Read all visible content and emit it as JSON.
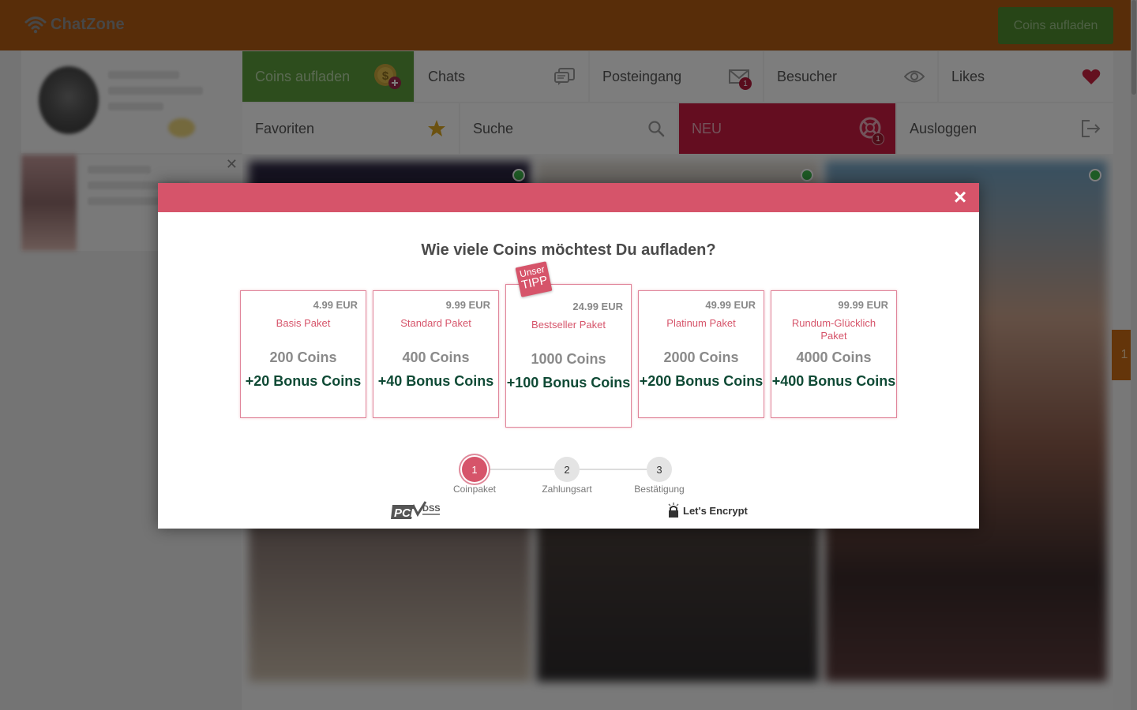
{
  "header": {
    "logo_text": "ChatZone",
    "cta_label": "Coins aufladen"
  },
  "nav": {
    "row1": [
      {
        "label": "Coins aufladen",
        "icon": "coin-plus-icon",
        "style": "green"
      },
      {
        "label": "Chats",
        "icon": "chat-bubbles-icon"
      },
      {
        "label": "Posteingang",
        "icon": "envelope-icon",
        "badge": "1"
      },
      {
        "label": "Besucher",
        "icon": "eye-icon"
      },
      {
        "label": "Likes",
        "icon": "heart-icon"
      }
    ],
    "row2": [
      {
        "label": "Favoriten",
        "icon": "star-icon"
      },
      {
        "label": "Suche",
        "icon": "search-icon"
      },
      {
        "label": "NEU",
        "icon": "lifebuoy-icon",
        "badge": "1",
        "style": "red"
      },
      {
        "label": "Ausloggen",
        "icon": "logout-icon"
      }
    ]
  },
  "side_tab": {
    "value": "1"
  },
  "modal": {
    "title": "Wie viele Coins möchtest Du aufladen?",
    "close_label": "×",
    "tipp": {
      "line1": "Unser",
      "line2": "TIPP"
    },
    "packages": [
      {
        "price": "4.99 EUR",
        "name": "Basis Paket",
        "coins": "200 Coins",
        "bonus": "+20 Bonus Coins"
      },
      {
        "price": "9.99 EUR",
        "name": "Standard Paket",
        "coins": "400 Coins",
        "bonus": "+40 Bonus Coins"
      },
      {
        "price": "24.99 EUR",
        "name": "Bestseller Paket",
        "coins": "1000 Coins",
        "bonus": "+100 Bonus Coins",
        "featured": true
      },
      {
        "price": "49.99 EUR",
        "name": "Platinum Paket",
        "coins": "2000 Coins",
        "bonus": "+200 Bonus Coins"
      },
      {
        "price": "99.99 EUR",
        "name": "Rundum-Glücklich Paket",
        "coins": "4000 Coins",
        "bonus": "+400 Bonus Coins"
      }
    ],
    "steps": [
      {
        "number": "1",
        "label": "Coinpaket",
        "active": true
      },
      {
        "number": "2",
        "label": "Zahlungsart"
      },
      {
        "number": "3",
        "label": "Bestätigung"
      }
    ],
    "badges": {
      "pci_text": "PCI",
      "pci_sub": "DSS",
      "letsencrypt_text": "Let's Encrypt"
    }
  },
  "colors": {
    "header": "#b05a12",
    "accent": "#d6546a",
    "green": "#5a9a3a",
    "bonus": "#0f4a35"
  }
}
